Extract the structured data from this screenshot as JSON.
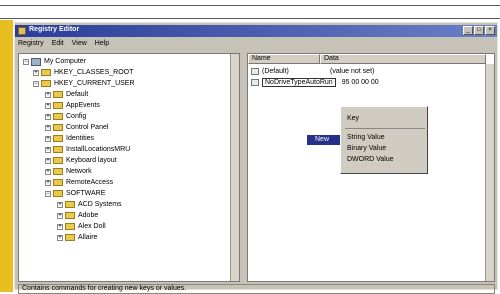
{
  "window": {
    "title": "Registry Editor"
  },
  "menu": [
    "Registry",
    "Edit",
    "View",
    "Help"
  ],
  "tree": {
    "root": "My Computer",
    "items": [
      "HKEY_CLASSES_ROOT",
      "HKEY_CURRENT_USER",
      "Default",
      "AppEvents",
      "Config",
      "Control Panel",
      "Identities",
      "InstallLocationsMRU",
      "Keyboard layout",
      "Network",
      "RemoteAccess",
      "SOFTWARE",
      "ACD Systems",
      "Adobe",
      "Alex Doll",
      "Allaire"
    ]
  },
  "list": {
    "headers": [
      "Name",
      "Data"
    ],
    "rows": [
      {
        "name": "(Default)",
        "data": "(value not set)"
      },
      {
        "name": "NoDriveTypeAutoRun",
        "data": "95 00 00 00"
      }
    ]
  },
  "context": {
    "trigger": "New",
    "items": [
      "Key",
      "String Value",
      "Binary Value",
      "DWORD Value"
    ]
  },
  "status": "Contains commands for creating new keys or values."
}
